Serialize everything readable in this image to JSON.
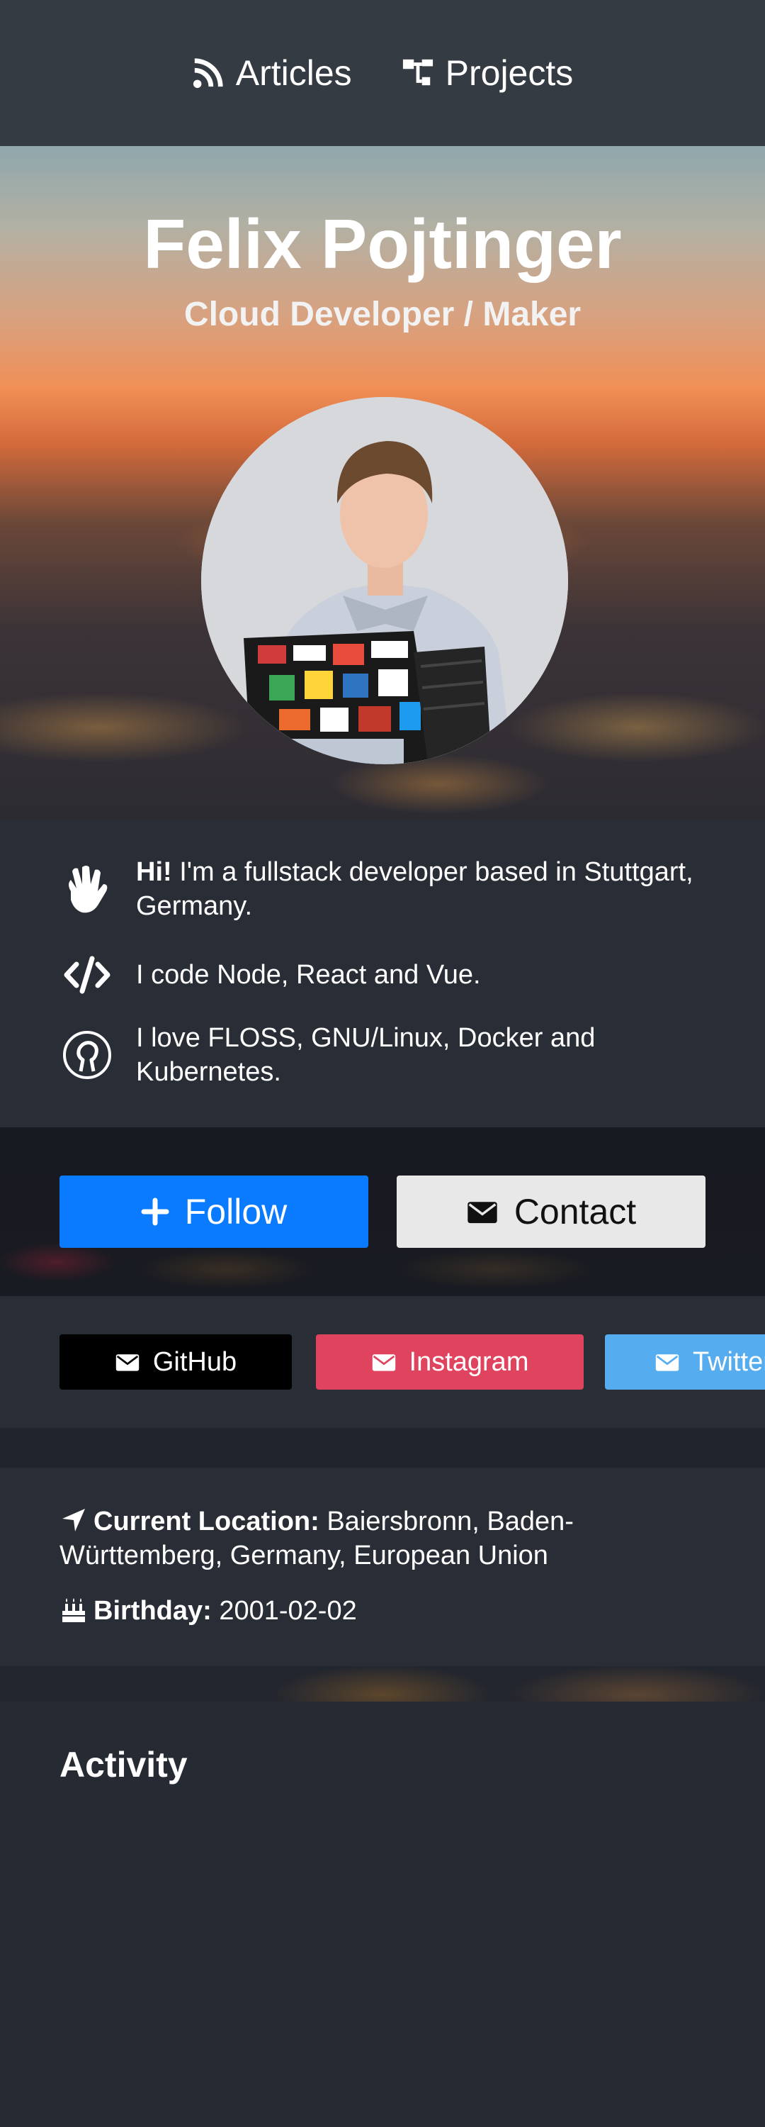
{
  "nav": {
    "items": [
      {
        "label": "Articles",
        "icon": "rss-icon"
      },
      {
        "label": "Projects",
        "icon": "sitemap-icon"
      }
    ]
  },
  "hero": {
    "name": "Felix Pojtinger",
    "subtitle": "Cloud Developer / Maker"
  },
  "about": {
    "greeting_bold": "Hi!",
    "greeting_text": " I'm a fullstack developer based in Stuttgart, Germany.",
    "code_text": "I code Node, React and Vue.",
    "floss_text": "I love FLOSS, GNU/Linux, Docker and Kubernetes."
  },
  "actions": {
    "follow_label": "Follow",
    "contact_label": "Contact",
    "follow_color": "#0a7bff",
    "contact_color": "#e8e8e8"
  },
  "social": [
    {
      "label": "GitHub",
      "color": "#000000"
    },
    {
      "label": "Instagram",
      "color": "#e0435d"
    },
    {
      "label": "Twitter",
      "color": "#55acee"
    }
  ],
  "info": {
    "location_label": "Current Location:",
    "location_value": " Baiersbronn, Baden-Württemberg, Germany, European Union",
    "birthday_label": "Birthday:",
    "birthday_value": " 2001-02-02"
  },
  "activity": {
    "title": "Activity"
  }
}
